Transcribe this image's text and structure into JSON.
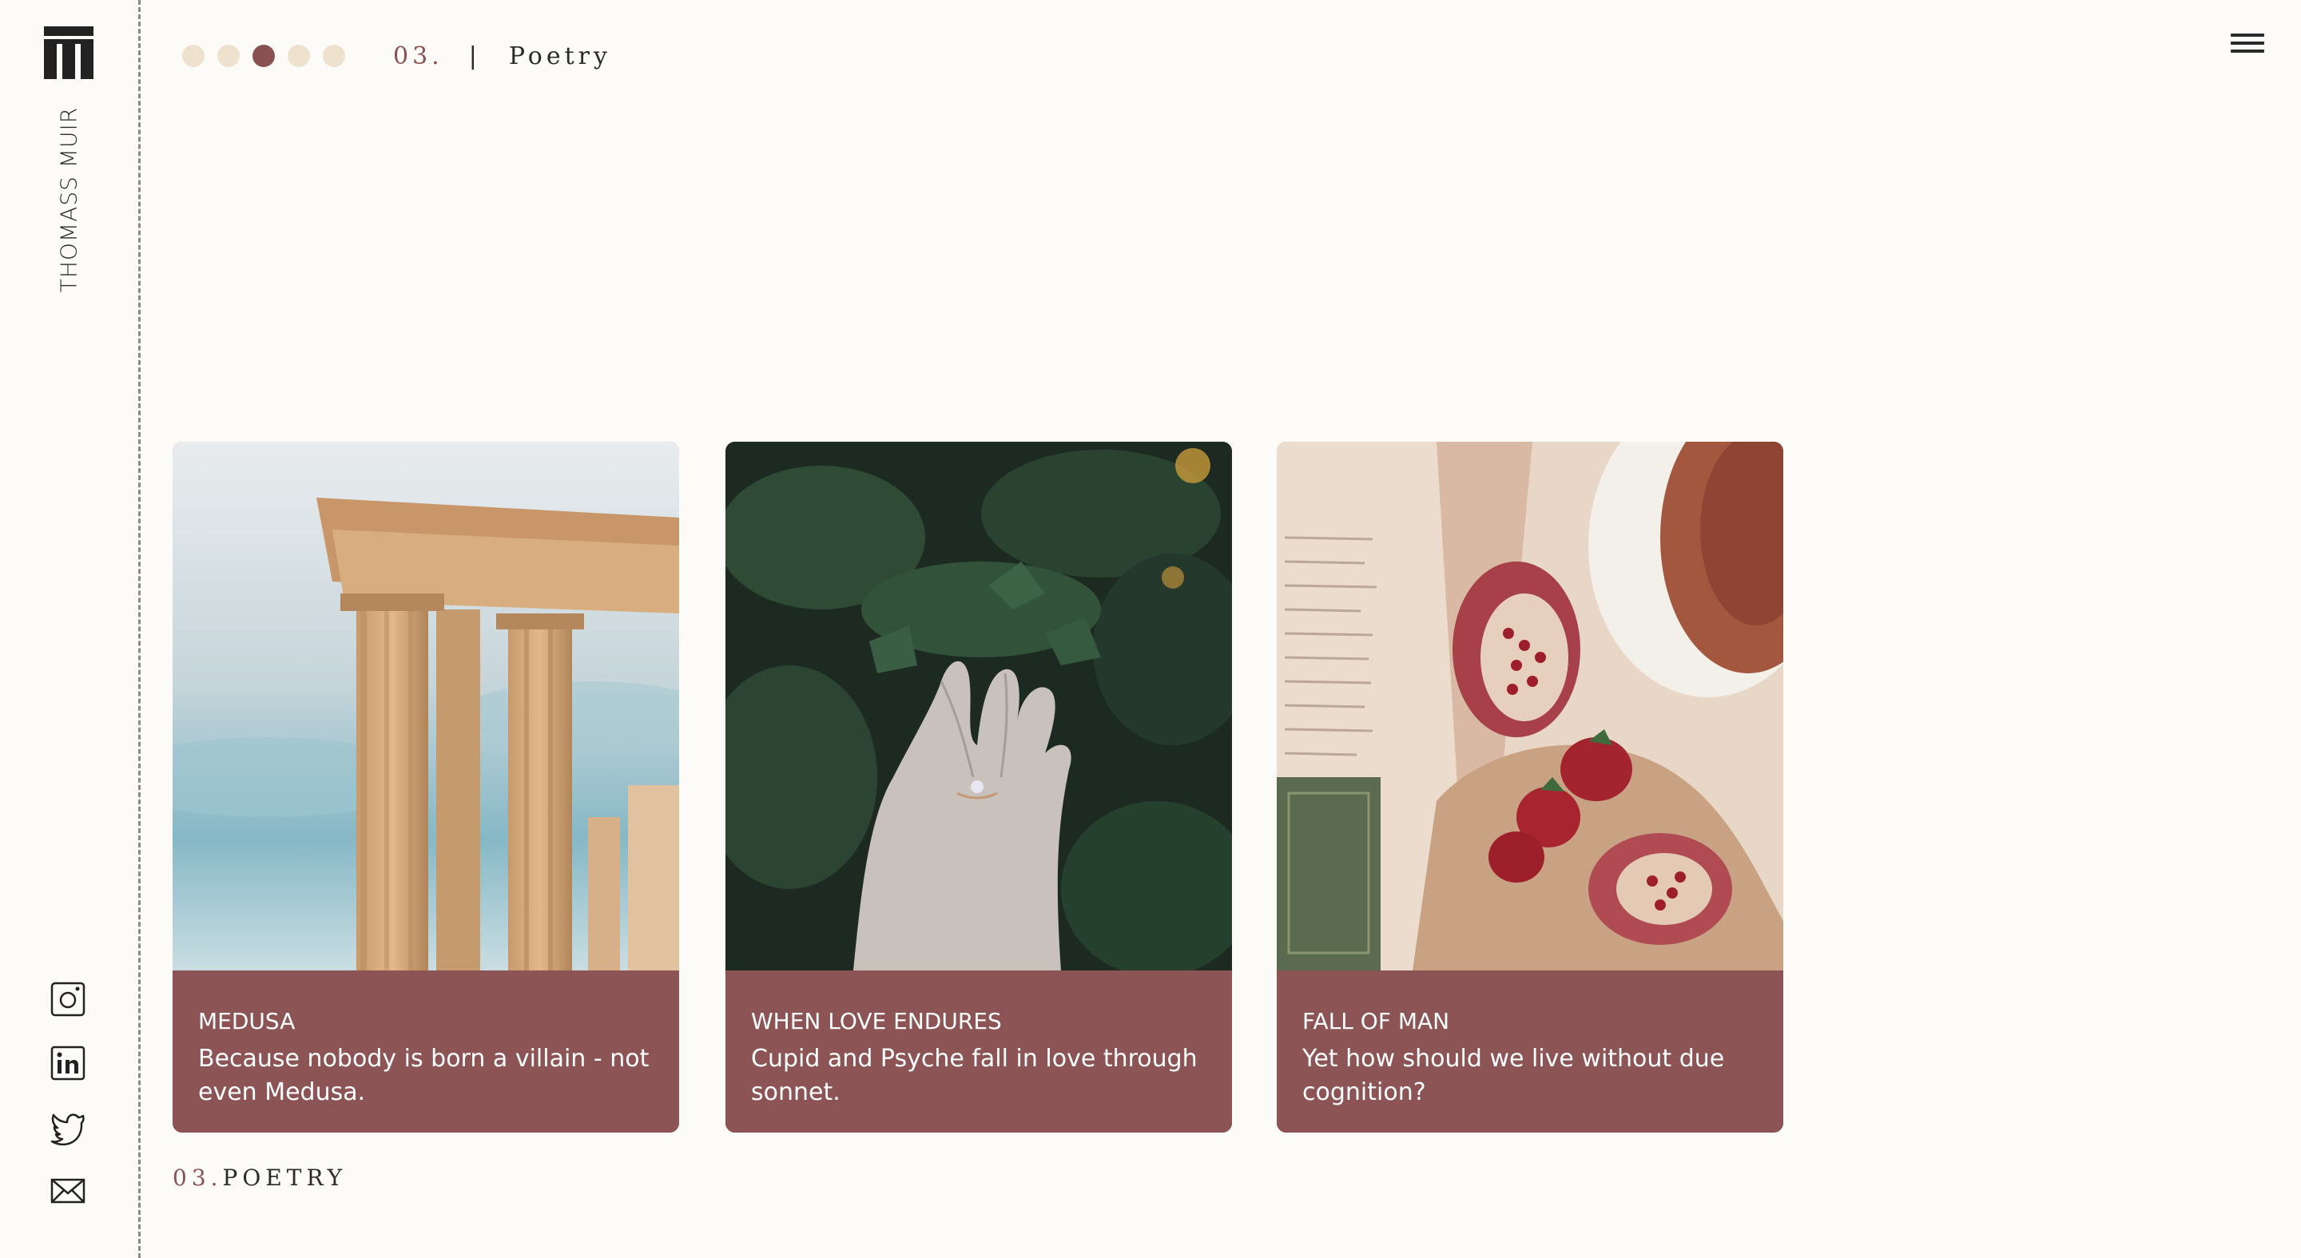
{
  "brand": {
    "author": "THOMASS MUIR",
    "logo_icon": "columns-logo-icon"
  },
  "header": {
    "dots": [
      {
        "active": false
      },
      {
        "active": false
      },
      {
        "active": true
      },
      {
        "active": false
      },
      {
        "active": false
      }
    ],
    "section_number": "03.",
    "separator": "|",
    "section_title": "Poetry",
    "menu_icon": "hamburger-menu-icon"
  },
  "socials": [
    {
      "name": "instagram",
      "icon": "instagram-icon"
    },
    {
      "name": "linkedin",
      "icon": "linkedin-icon"
    },
    {
      "name": "twitter",
      "icon": "twitter-icon"
    },
    {
      "name": "email",
      "icon": "mail-icon"
    }
  ],
  "cards": [
    {
      "title": "MEDUSA",
      "description": "Because nobody is born a villain - not even Medusa."
    },
    {
      "title": "WHEN LOVE ENDURES",
      "description": "Cupid and Psyche fall in love through sonnet."
    },
    {
      "title": "FALL OF MAN",
      "description": "Yet how should we live without due cognition?"
    }
  ],
  "footer": {
    "number": "03.",
    "title": "POETRY"
  },
  "colors": {
    "accent": "#8a5153",
    "card_caption_bg": "#8c5455",
    "dot_inactive": "#eee2cf",
    "background": "#fcfbf7"
  }
}
